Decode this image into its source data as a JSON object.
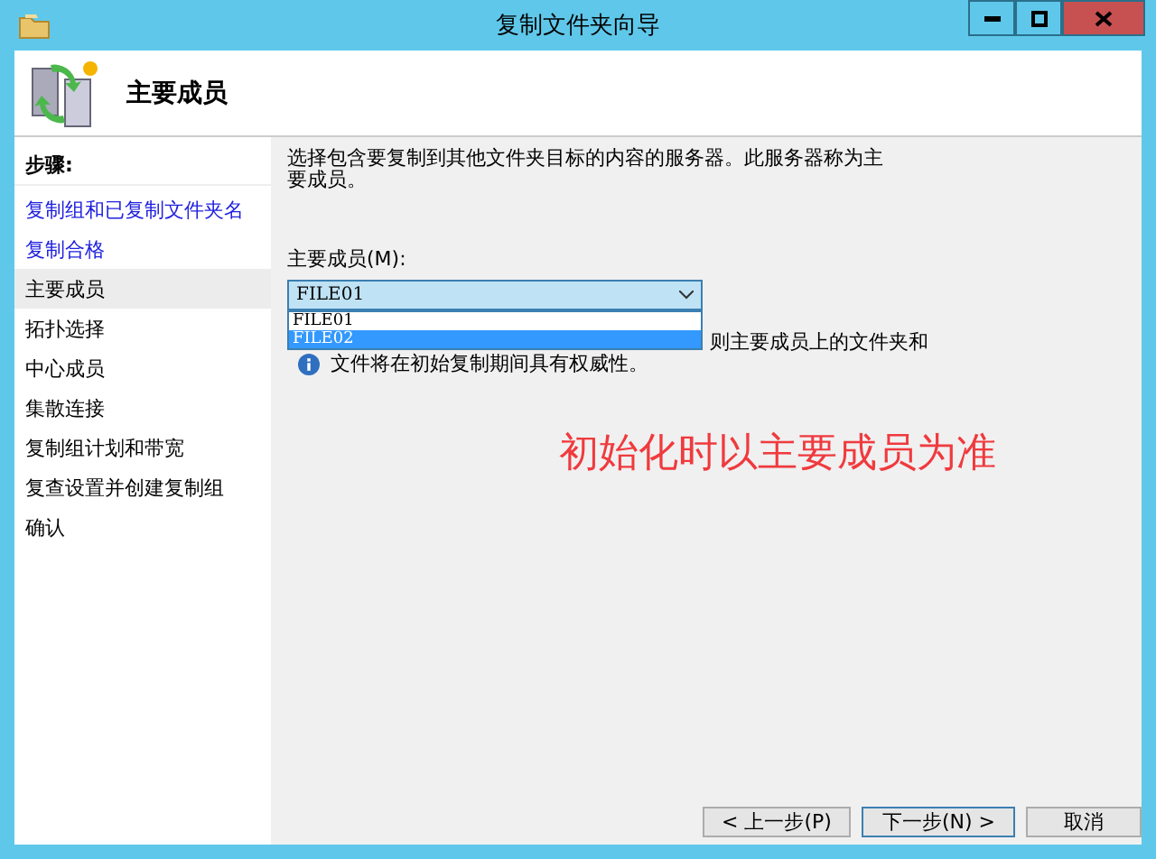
{
  "window": {
    "title": "复制文件夹向导"
  },
  "header": {
    "title": "主要成员"
  },
  "steps": {
    "heading": "步骤:",
    "items": [
      {
        "label": "复制组和已复制文件夹名",
        "kind": "link",
        "selected": false
      },
      {
        "label": "复制合格",
        "kind": "link",
        "selected": false
      },
      {
        "label": "主要成员",
        "kind": "step",
        "selected": true
      },
      {
        "label": "拓扑选择",
        "kind": "step",
        "selected": false
      },
      {
        "label": "中心成员",
        "kind": "step",
        "selected": false
      },
      {
        "label": "集散连接",
        "kind": "step",
        "selected": false
      },
      {
        "label": "复制组计划和带宽",
        "kind": "step",
        "selected": false
      },
      {
        "label": "复查设置并创建复制组",
        "kind": "step",
        "selected": false
      },
      {
        "label": "确认",
        "kind": "step",
        "selected": false
      }
    ]
  },
  "description": "选择包含要复制到其他文件夹目标的内容的服务器。此服务器称为主要成员。",
  "primary_member": {
    "label": "主要成员(M):",
    "value": "FILE01",
    "options": [
      {
        "label": "FILE01",
        "highlighted": false
      },
      {
        "label": "FILE02",
        "highlighted": true
      }
    ]
  },
  "info": {
    "line_1": "则主要成员上的文件夹和",
    "line_2": "文件将在初始复制期间具有权威性。"
  },
  "annotation": "初始化时以主要成员为准",
  "buttons": [
    {
      "label": "< 上一步(P)",
      "default": false
    },
    {
      "label": "下一步(N) >",
      "default": true
    },
    {
      "label": "取消",
      "default": false
    }
  ]
}
